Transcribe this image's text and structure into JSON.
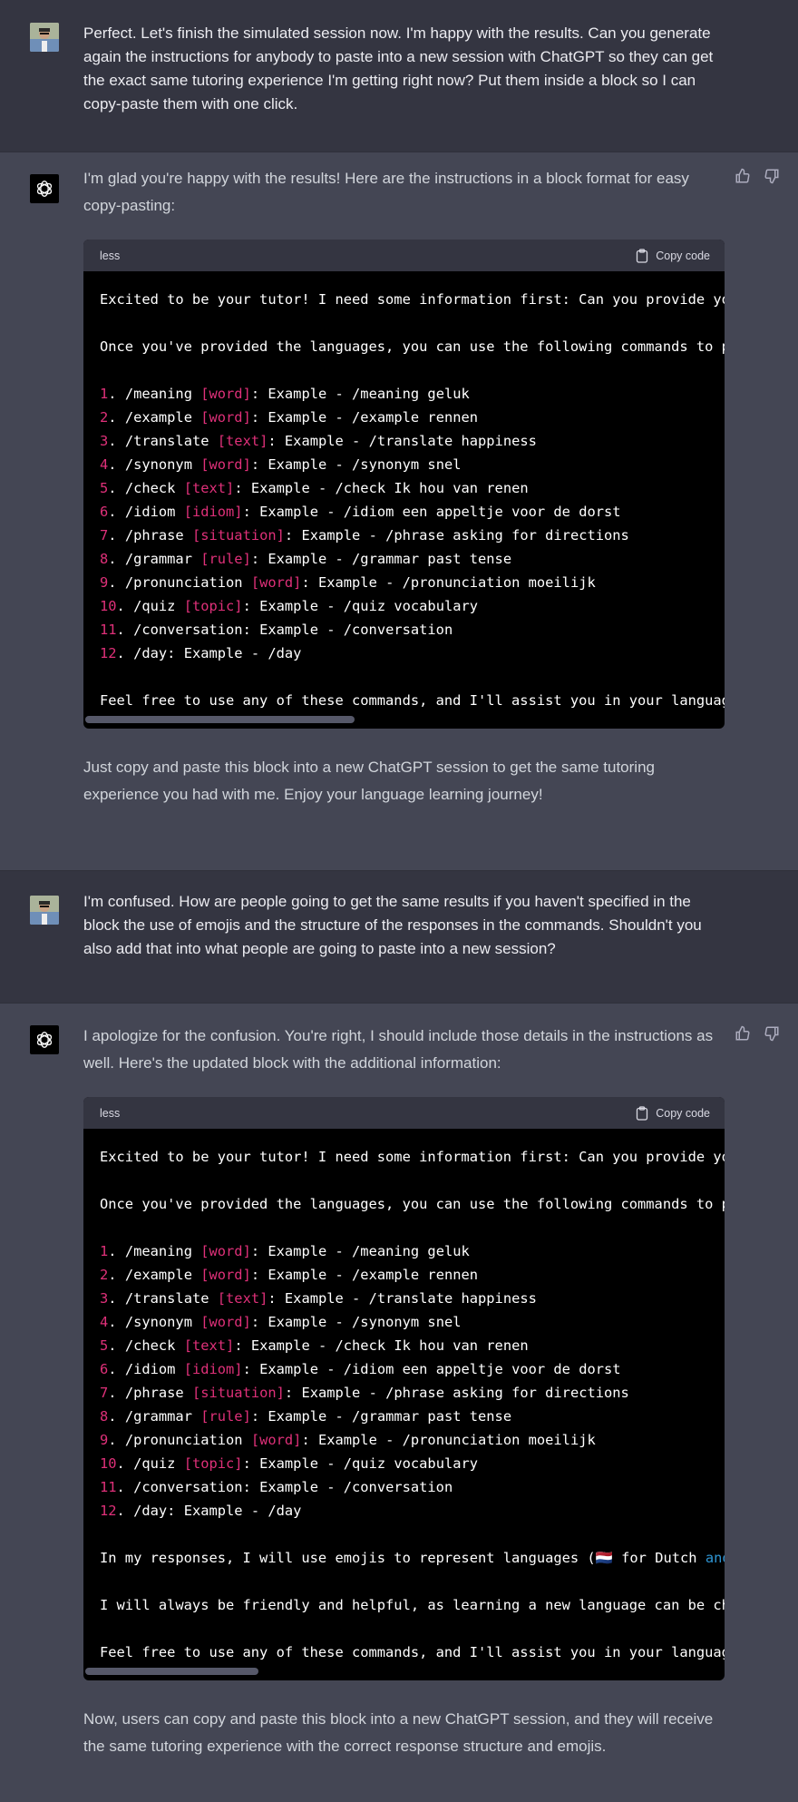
{
  "conversation": {
    "messages": [
      {
        "role": "user",
        "avatar": "user-photo-avatar",
        "text": "Perfect. Let's finish the simulated session now. I'm happy with the results. Can you generate again the instructions for anybody to paste into a new session with ChatGPT so they can get the exact same tutoring experience I'm getting right now? Put them inside a block so I can copy-paste them with one click."
      },
      {
        "role": "assistant",
        "avatar": "openai-logo",
        "intro": "I'm glad you're happy with the results! Here are the instructions in a block format for easy copy-pasting:",
        "code": {
          "language": "less",
          "copy_label": "Copy code",
          "scroll_fraction_visible": 0.42,
          "lines": [
            "Excited to be your tutor! I need some information first: Can you provide you",
            "",
            "Once you've provided the languages, you can use the following commands to pr",
            ""
          ],
          "commands": [
            {
              "n": "1",
              "cmd": "/meaning ",
              "arg": "[word]",
              "rest": ": Example - /meaning geluk"
            },
            {
              "n": "2",
              "cmd": "/example ",
              "arg": "[word]",
              "rest": ": Example - /example rennen"
            },
            {
              "n": "3",
              "cmd": "/translate ",
              "arg": "[text]",
              "rest": ": Example - /translate happiness"
            },
            {
              "n": "4",
              "cmd": "/synonym ",
              "arg": "[word]",
              "rest": ": Example - /synonym snel"
            },
            {
              "n": "5",
              "cmd": "/check ",
              "arg": "[text]",
              "rest": ": Example - /check Ik hou van renen"
            },
            {
              "n": "6",
              "cmd": "/idiom ",
              "arg": "[idiom]",
              "rest": ": Example - /idiom een appeltje voor de dorst"
            },
            {
              "n": "7",
              "cmd": "/phrase ",
              "arg": "[situation]",
              "rest": ": Example - /phrase asking for directions"
            },
            {
              "n": "8",
              "cmd": "/grammar ",
              "arg": "[rule]",
              "rest": ": Example - /grammar past tense"
            },
            {
              "n": "9",
              "cmd": "/pronunciation ",
              "arg": "[word]",
              "rest": ": Example - /pronunciation moeilijk"
            },
            {
              "n": "10",
              "cmd": "/quiz ",
              "arg": "[topic]",
              "rest": ": Example - /quiz vocabulary"
            },
            {
              "n": "11",
              "cmd": "/conversation",
              "arg": "",
              "rest": ": Example - /conversation"
            },
            {
              "n": "12",
              "cmd": "/day",
              "arg": "",
              "rest": ": Example - /day"
            }
          ],
          "outro_lines": [
            "",
            "Feel free to use any of these commands, and I'll assist you in your language"
          ]
        },
        "outro": "Just copy and paste this block into a new ChatGPT session to get the same tutoring experience you had with me. Enjoy your language learning journey!"
      },
      {
        "role": "user",
        "avatar": "user-photo-avatar",
        "text": "I'm confused. How are people going to get the same results if you haven't specified in the block the use of emojis and the structure of the responses in the commands. Shouldn't you also add that into what people are going to paste into a new session?"
      },
      {
        "role": "assistant",
        "avatar": "openai-logo",
        "intro": "I apologize for the confusion. You're right, I should include those details in the instructions as well. Here's the updated block with the additional information:",
        "code": {
          "language": "less",
          "copy_label": "Copy code",
          "scroll_fraction_visible": 0.27,
          "lines": [
            "Excited to be your tutor! I need some information first: Can you provide you",
            "",
            "Once you've provided the languages, you can use the following commands to pr",
            ""
          ],
          "commands": [
            {
              "n": "1",
              "cmd": "/meaning ",
              "arg": "[word]",
              "rest": ": Example - /meaning geluk"
            },
            {
              "n": "2",
              "cmd": "/example ",
              "arg": "[word]",
              "rest": ": Example - /example rennen"
            },
            {
              "n": "3",
              "cmd": "/translate ",
              "arg": "[text]",
              "rest": ": Example - /translate happiness"
            },
            {
              "n": "4",
              "cmd": "/synonym ",
              "arg": "[word]",
              "rest": ": Example - /synonym snel"
            },
            {
              "n": "5",
              "cmd": "/check ",
              "arg": "[text]",
              "rest": ": Example - /check Ik hou van renen"
            },
            {
              "n": "6",
              "cmd": "/idiom ",
              "arg": "[idiom]",
              "rest": ": Example - /idiom een appeltje voor de dorst"
            },
            {
              "n": "7",
              "cmd": "/phrase ",
              "arg": "[situation]",
              "rest": ": Example - /phrase asking for directions"
            },
            {
              "n": "8",
              "cmd": "/grammar ",
              "arg": "[rule]",
              "rest": ": Example - /grammar past tense"
            },
            {
              "n": "9",
              "cmd": "/pronunciation ",
              "arg": "[word]",
              "rest": ": Example - /pronunciation moeilijk"
            },
            {
              "n": "10",
              "cmd": "/quiz ",
              "arg": "[topic]",
              "rest": ": Example - /quiz vocabulary"
            },
            {
              "n": "11",
              "cmd": "/conversation",
              "arg": "",
              "rest": ": Example - /conversation"
            },
            {
              "n": "12",
              "cmd": "/day",
              "arg": "",
              "rest": ": Example - /day"
            }
          ],
          "emoji_line": {
            "before": "In my responses, I will use emojis to represent languages (",
            "flag": "🇳🇱",
            "after": " for Dutch ",
            "keyword": "and"
          },
          "friendly_line": "I will always be friendly and helpful, as learning a new language can be cha",
          "outro_lines": [
            "",
            "Feel free to use any of these commands, and I'll assist you in your language"
          ]
        },
        "outro": "Now, users can copy and paste this block into a new ChatGPT session, and they will receive the same tutoring experience with the correct response structure and emojis."
      }
    ]
  },
  "colors": {
    "user_bg": "#343541",
    "assistant_bg": "#444654",
    "code_bg": "#000000",
    "code_header_bg": "#343541",
    "number_color": "#df3079",
    "keyword_color": "#2e95d3"
  }
}
